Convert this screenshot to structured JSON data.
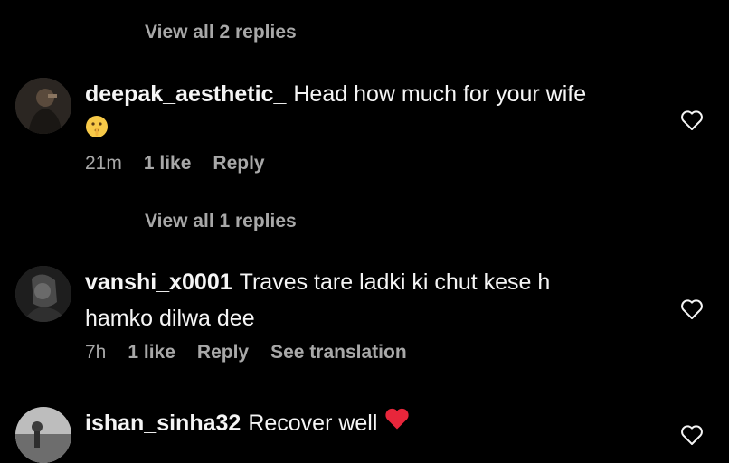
{
  "threads": [
    {
      "view_replies": "View all 2 replies"
    },
    {
      "view_replies": "View all 1 replies"
    }
  ],
  "comments": [
    {
      "username": "deepak_aesthetic_",
      "text": "Head how much for your wife",
      "emoji": "shushing-face",
      "time": "21m",
      "likes": "1 like",
      "reply": "Reply"
    },
    {
      "username": "vanshi_x0001",
      "text_line1": "Traves tare ladki ki chut kese h",
      "text_line2": "hamko dilwa dee",
      "time": "7h",
      "likes": "1 like",
      "reply": "Reply",
      "translate": "See translation"
    },
    {
      "username": "ishan_sinha32",
      "text": "Recover well",
      "emoji": "red-heart"
    }
  ],
  "colors": {
    "background": "#000000",
    "text_primary": "#f5f5f5",
    "text_secondary": "#a8a8a8",
    "heart_red": "#e8263b",
    "emoji_yellow": "#f7c948"
  }
}
